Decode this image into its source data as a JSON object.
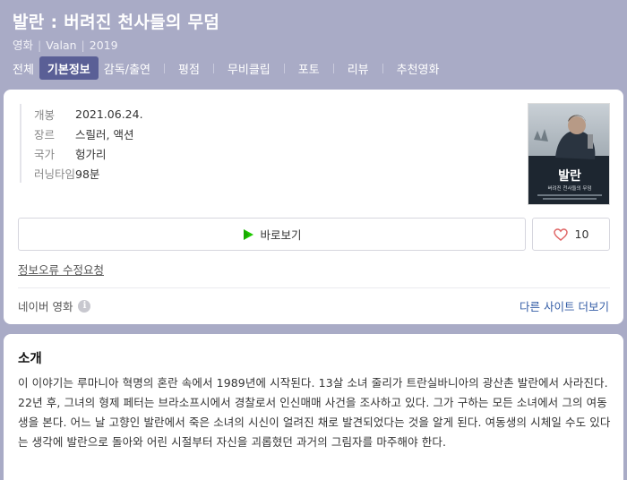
{
  "movie": {
    "title": "발란 : 버려진 천사들의 무덤",
    "meta": [
      "영화",
      "Valan",
      "2019"
    ]
  },
  "tabs": [
    {
      "label": "전체",
      "active": false
    },
    {
      "label": "기본정보",
      "active": true
    },
    {
      "label": "감독/출연",
      "active": false
    },
    {
      "label": "평점",
      "active": false
    },
    {
      "label": "무비클립",
      "active": false
    },
    {
      "label": "포토",
      "active": false
    },
    {
      "label": "리뷰",
      "active": false
    },
    {
      "label": "추천영화",
      "active": false
    }
  ],
  "info": [
    {
      "label": "개봉",
      "value": "2021.06.24."
    },
    {
      "label": "장르",
      "value": "스릴러, 액션"
    },
    {
      "label": "국가",
      "value": "헝가리"
    },
    {
      "label": "러닝타임",
      "value": "98분"
    }
  ],
  "poster": {
    "title": "발란",
    "subtitle": "버려진 천사들의 무덤"
  },
  "actions": {
    "watch_label": "바로보기",
    "like_count": "10"
  },
  "report_label": "정보오류 수정요청",
  "source": {
    "label": "네이버 영화",
    "more_label": "다른 사이트 더보기"
  },
  "synopsis": {
    "title": "소개",
    "text": "이 이야기는 루마니아 혁명의 혼란 속에서 1989년에 시작된다. 13살 소녀 줄리가 트란실바니아의 광산촌 발란에서 사라진다. 22년 후, 그녀의 형제 페터는 브라소프시에서 경찰로서 인신매매 사건을 조사하고 있다. 그가 구하는 모든 소녀에서 그의 여동생을 본다. 어느 날 고향인 발란에서 죽은 소녀의 시신이 얼려진 채로 발견되었다는 것을 알게 된다. 여동생의 시체일 수도 있다는 생각에 발란으로 돌아와 어린 시절부터 자신을 괴롭혔던 과거의 그림자를 마주해야 한다."
  },
  "colors": {
    "header_bg": "#a9abc6",
    "active_tab": "#5a5f96",
    "link": "#345da6",
    "play_green": "#1ec800",
    "heart": "#e06666"
  }
}
